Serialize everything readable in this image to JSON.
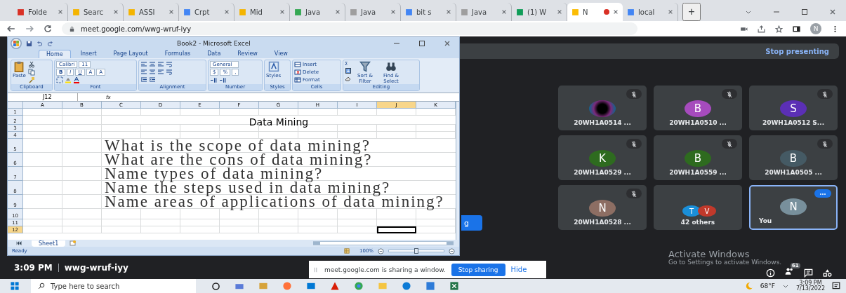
{
  "browser": {
    "tabs": [
      {
        "label": "Folde",
        "selected": false,
        "recording": false,
        "color": "#d93025"
      },
      {
        "label": "Searc",
        "selected": false,
        "recording": false,
        "color": "#f4b400"
      },
      {
        "label": "ASSI",
        "selected": false,
        "recording": false,
        "color": "#f4b400"
      },
      {
        "label": "Crpt",
        "selected": false,
        "recording": false,
        "color": "#4285f4"
      },
      {
        "label": "Mid",
        "selected": false,
        "recording": false,
        "color": "#f4b400"
      },
      {
        "label": "Java",
        "selected": false,
        "recording": false,
        "color": "#34a853"
      },
      {
        "label": "Java",
        "selected": false,
        "recording": false,
        "color": "#9e9e9e"
      },
      {
        "label": "bit s",
        "selected": false,
        "recording": false,
        "color": "#4285f4"
      },
      {
        "label": "Java",
        "selected": false,
        "recording": false,
        "color": "#9e9e9e"
      },
      {
        "label": "(1) W",
        "selected": false,
        "recording": false,
        "color": "#0f9d58"
      },
      {
        "label": "N",
        "selected": true,
        "recording": true,
        "color": "#fbbc04"
      },
      {
        "label": "local",
        "selected": false,
        "recording": false,
        "color": "#4285f4"
      }
    ],
    "new_tab": "+",
    "url": "meet.google.com/wwg-wruf-iyy",
    "profile": "N"
  },
  "excel": {
    "title": "Book2 - Microsoft Excel",
    "tabs": [
      {
        "label": "Home",
        "selected": true
      },
      {
        "label": "Insert",
        "selected": false
      },
      {
        "label": "Page Layout",
        "selected": false
      },
      {
        "label": "Formulas",
        "selected": false
      },
      {
        "label": "Data",
        "selected": false
      },
      {
        "label": "Review",
        "selected": false
      },
      {
        "label": "View",
        "selected": false
      }
    ],
    "groups": [
      {
        "kind": "clipboard",
        "name": "Clipboard",
        "labels": [
          "Paste"
        ]
      },
      {
        "kind": "font",
        "name": "Font",
        "labels": [
          "Calibri",
          "11",
          "B",
          "I",
          "U",
          "A",
          "A"
        ]
      },
      {
        "kind": "alignment",
        "name": "Alignment"
      },
      {
        "kind": "number",
        "name": "Number",
        "labels": [
          "General",
          "$",
          "%",
          ","
        ]
      },
      {
        "kind": "styles",
        "name": "Styles",
        "labels": [
          "Styles"
        ]
      },
      {
        "kind": "cells",
        "name": "Cells",
        "labels": [
          "Insert",
          "Delete",
          "Format"
        ]
      },
      {
        "kind": "editing",
        "name": "Editing",
        "labels": [
          "Σ",
          "Sort & Filter",
          "Find & Select"
        ]
      }
    ],
    "name_box": "J12",
    "fx": "fx",
    "columns": [
      {
        "label": "A",
        "selected": false
      },
      {
        "label": "B",
        "selected": false
      },
      {
        "label": "C",
        "selected": false
      },
      {
        "label": "D",
        "selected": false
      },
      {
        "label": "E",
        "selected": false
      },
      {
        "label": "F",
        "selected": false
      },
      {
        "label": "G",
        "selected": false
      },
      {
        "label": "H",
        "selected": false
      },
      {
        "label": "I",
        "selected": false
      },
      {
        "label": "J",
        "selected": true
      },
      {
        "label": "K",
        "selected": false
      }
    ],
    "rows": [
      {
        "label": "1",
        "selected": false,
        "kind": "empty"
      },
      {
        "label": "2",
        "selected": false,
        "kind": "title",
        "text": "Data Mining"
      },
      {
        "label": "3",
        "selected": false,
        "kind": "empty"
      },
      {
        "label": "4",
        "selected": false,
        "kind": "empty"
      },
      {
        "label": "5",
        "selected": false,
        "kind": "question",
        "text": "What is the scope of data mining?"
      },
      {
        "label": "6",
        "selected": false,
        "kind": "question",
        "text": "What are the cons of data mining?"
      },
      {
        "label": "7",
        "selected": false,
        "kind": "question",
        "text": "Name types of data mining?"
      },
      {
        "label": "8",
        "selected": false,
        "kind": "question",
        "text": "Name the steps used in data mining?"
      },
      {
        "label": "9",
        "selected": false,
        "kind": "question",
        "text": "Name areas of applications of data mining?"
      },
      {
        "label": "10",
        "selected": false,
        "kind": "tall"
      },
      {
        "label": "11",
        "selected": false,
        "kind": "empty"
      },
      {
        "label": "12",
        "selected": true,
        "kind": "empty"
      }
    ],
    "sheet_tab": "Sheet1",
    "status": "Ready",
    "zoom": "100%",
    "zoom_slider": {
      "level": 0.5
    }
  },
  "meet": {
    "stop_presenting": "Stop presenting",
    "present_button": "g",
    "tiles": [
      {
        "kind": "photo",
        "name": "20WH1A0514 ...",
        "muted": true,
        "selected": false
      },
      {
        "kind": "letter",
        "initial": "B",
        "color": "#a64bbd",
        "name": "20WH1A0510 ...",
        "muted": true,
        "selected": false
      },
      {
        "kind": "letter",
        "initial": "S",
        "color": "#5b2fb5",
        "name": "20WH1A0512 S...",
        "muted": true,
        "selected": false
      },
      {
        "kind": "letter",
        "initial": "K",
        "color": "#2e6b1f",
        "name": "20WH1A0529 ...",
        "muted": true,
        "selected": false
      },
      {
        "kind": "letter",
        "initial": "B",
        "color": "#2e6b1f",
        "name": "20WH1A0559 ...",
        "muted": true,
        "selected": false
      },
      {
        "kind": "letter",
        "initial": "B",
        "color": "#455a64",
        "name": "20WH1A0505 ...",
        "muted": true,
        "selected": false
      },
      {
        "kind": "letter",
        "initial": "N",
        "color": "#8d6e63",
        "name": "20WH1A0528 ...",
        "muted": true,
        "selected": false
      },
      {
        "kind": "others",
        "avatars": [
          {
            "initial": "T",
            "color": "#1a8fd9"
          },
          {
            "initial": "V",
            "color": "#c0392b"
          }
        ],
        "name": "42 others",
        "muted": false,
        "selected": false
      },
      {
        "kind": "self",
        "initial": "N",
        "color": "#78909c",
        "name": "You",
        "muted": false,
        "selected": true
      }
    ],
    "time": "3:09 PM",
    "code": "wwg-wruf-iyy",
    "people_badge": "61"
  },
  "share_bar": {
    "message": "meet.google.com is sharing a window.",
    "stop": "Stop sharing",
    "hide": "Hide"
  },
  "activation": {
    "title": "Activate Windows",
    "hint": "Go to Settings to activate Windows."
  },
  "taskbar": {
    "search_placeholder": "Type here to search",
    "weather": "68°F",
    "time": "3:09 PM",
    "date": "7/13/2022"
  }
}
